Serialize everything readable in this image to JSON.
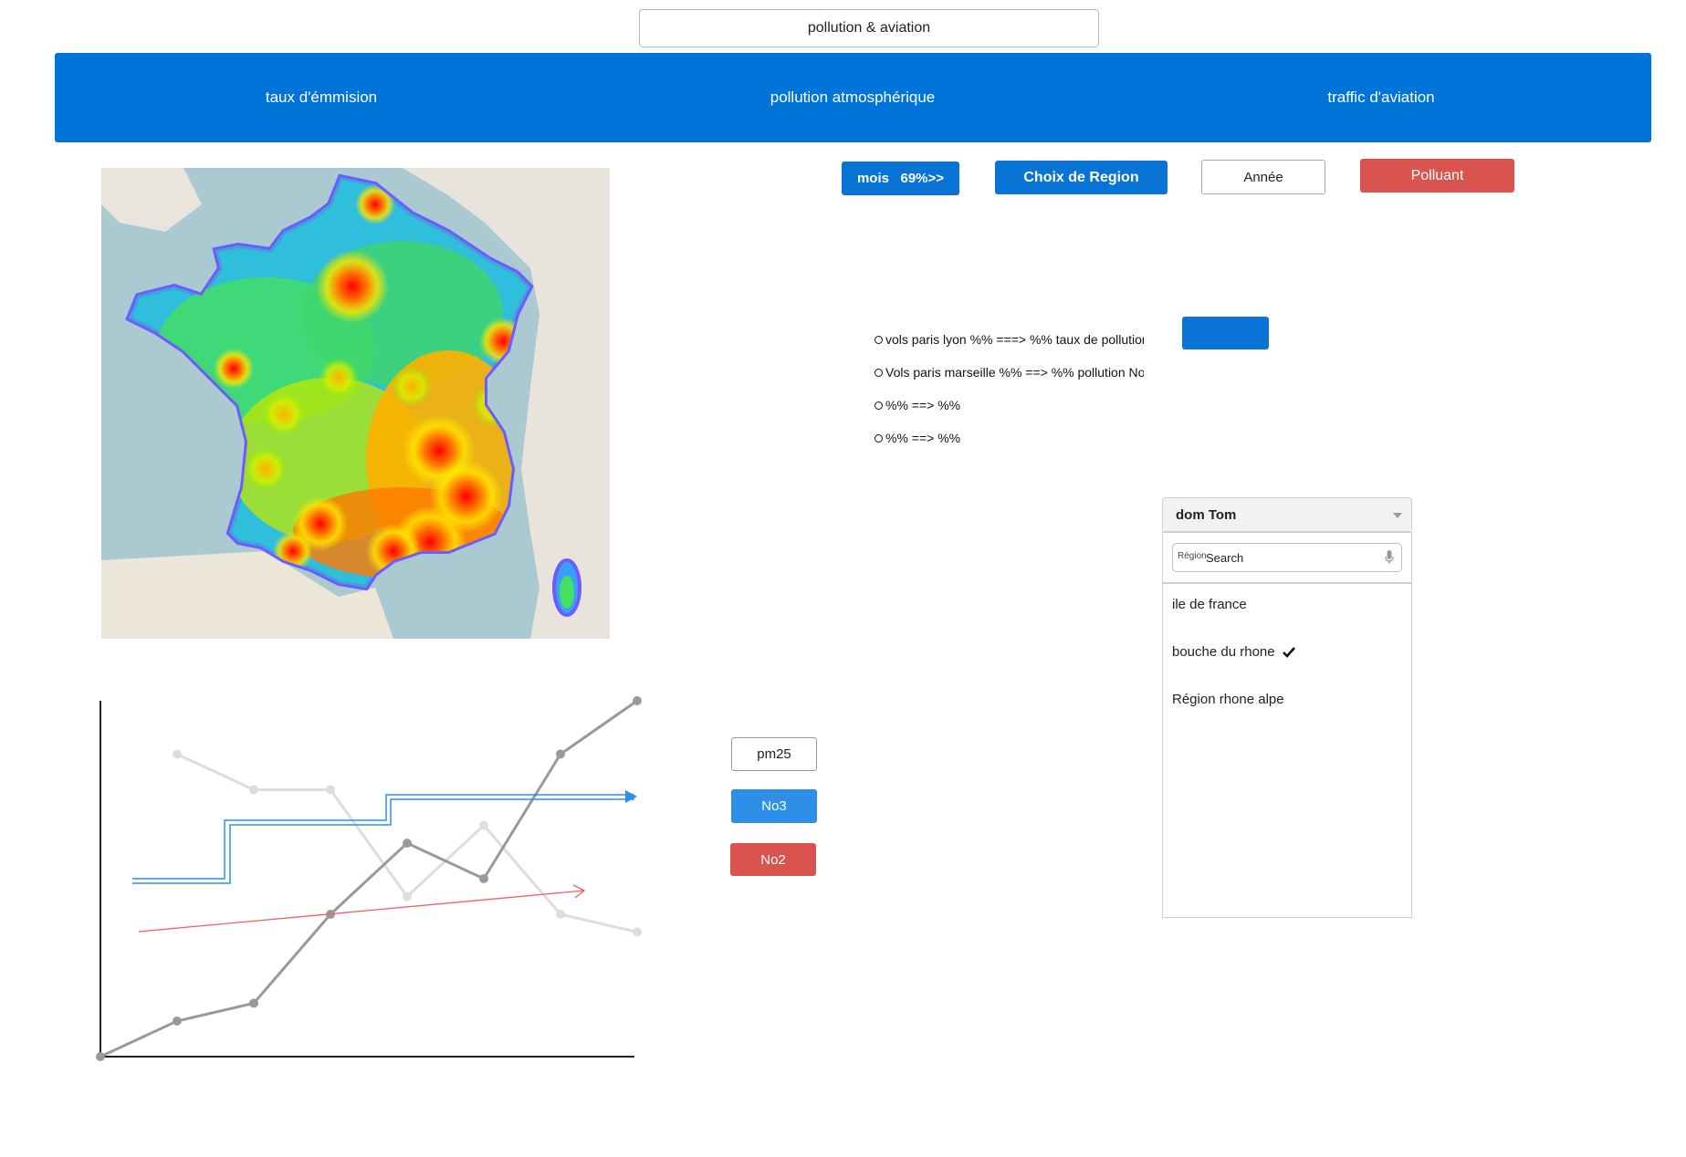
{
  "header": {
    "title": "pollution & aviation"
  },
  "nav": {
    "items": [
      {
        "label": "taux d'émmision"
      },
      {
        "label": "pollution atmosphérique"
      },
      {
        "label": "traffic d'aviation"
      }
    ],
    "color": "#0074d9"
  },
  "filters": {
    "mois_label": "mois   69%>>",
    "region_label": "Choix de Region",
    "annee_label": "Année",
    "polluant_label": "Polluant"
  },
  "flights": [
    {
      "text": "vols paris lyon %% ===> %% taux de pollution"
    },
    {
      "text": "Vols paris marseille %% ==> %% pollution No"
    },
    {
      "text": "%% ==> %%"
    },
    {
      "text": "%% ==> %%"
    }
  ],
  "region_dropdown": {
    "selected": "dom Tom",
    "search_label": "Région",
    "search_placeholder": "Search",
    "options": [
      {
        "label": "ile de france",
        "checked": false
      },
      {
        "label": "bouche du rhone",
        "checked": true
      },
      {
        "label": "Région rhone alpe",
        "checked": false
      }
    ]
  },
  "pollutant_buttons": {
    "pm25": "pm25",
    "no3": "No3",
    "no2": "No2"
  },
  "map": {
    "type": "heatmap",
    "region": "France",
    "icon": "heatmap-map"
  },
  "colors": {
    "blue": "#0a74d6",
    "red": "#d9534f",
    "light_blue": "#2d8fe8"
  },
  "chart_data": {
    "type": "line",
    "title": "",
    "xlabel": "",
    "ylabel": "",
    "x": [
      0,
      1,
      2,
      3,
      4,
      5,
      6,
      7
    ],
    "series": [
      {
        "values": [
          0,
          1,
          1.5,
          4,
          6,
          5,
          8.5,
          10
        ],
        "color": "#999999"
      },
      {
        "values": [
          null,
          8.5,
          7.5,
          7.5,
          4.5,
          6.5,
          4,
          3.5
        ],
        "color": "#dddddd"
      }
    ],
    "annotations": [
      {
        "kind": "step-arrow",
        "color": "#2d8fe8"
      },
      {
        "kind": "arrow",
        "color": "#f06060"
      }
    ],
    "ylim": [
      0,
      10
    ]
  }
}
